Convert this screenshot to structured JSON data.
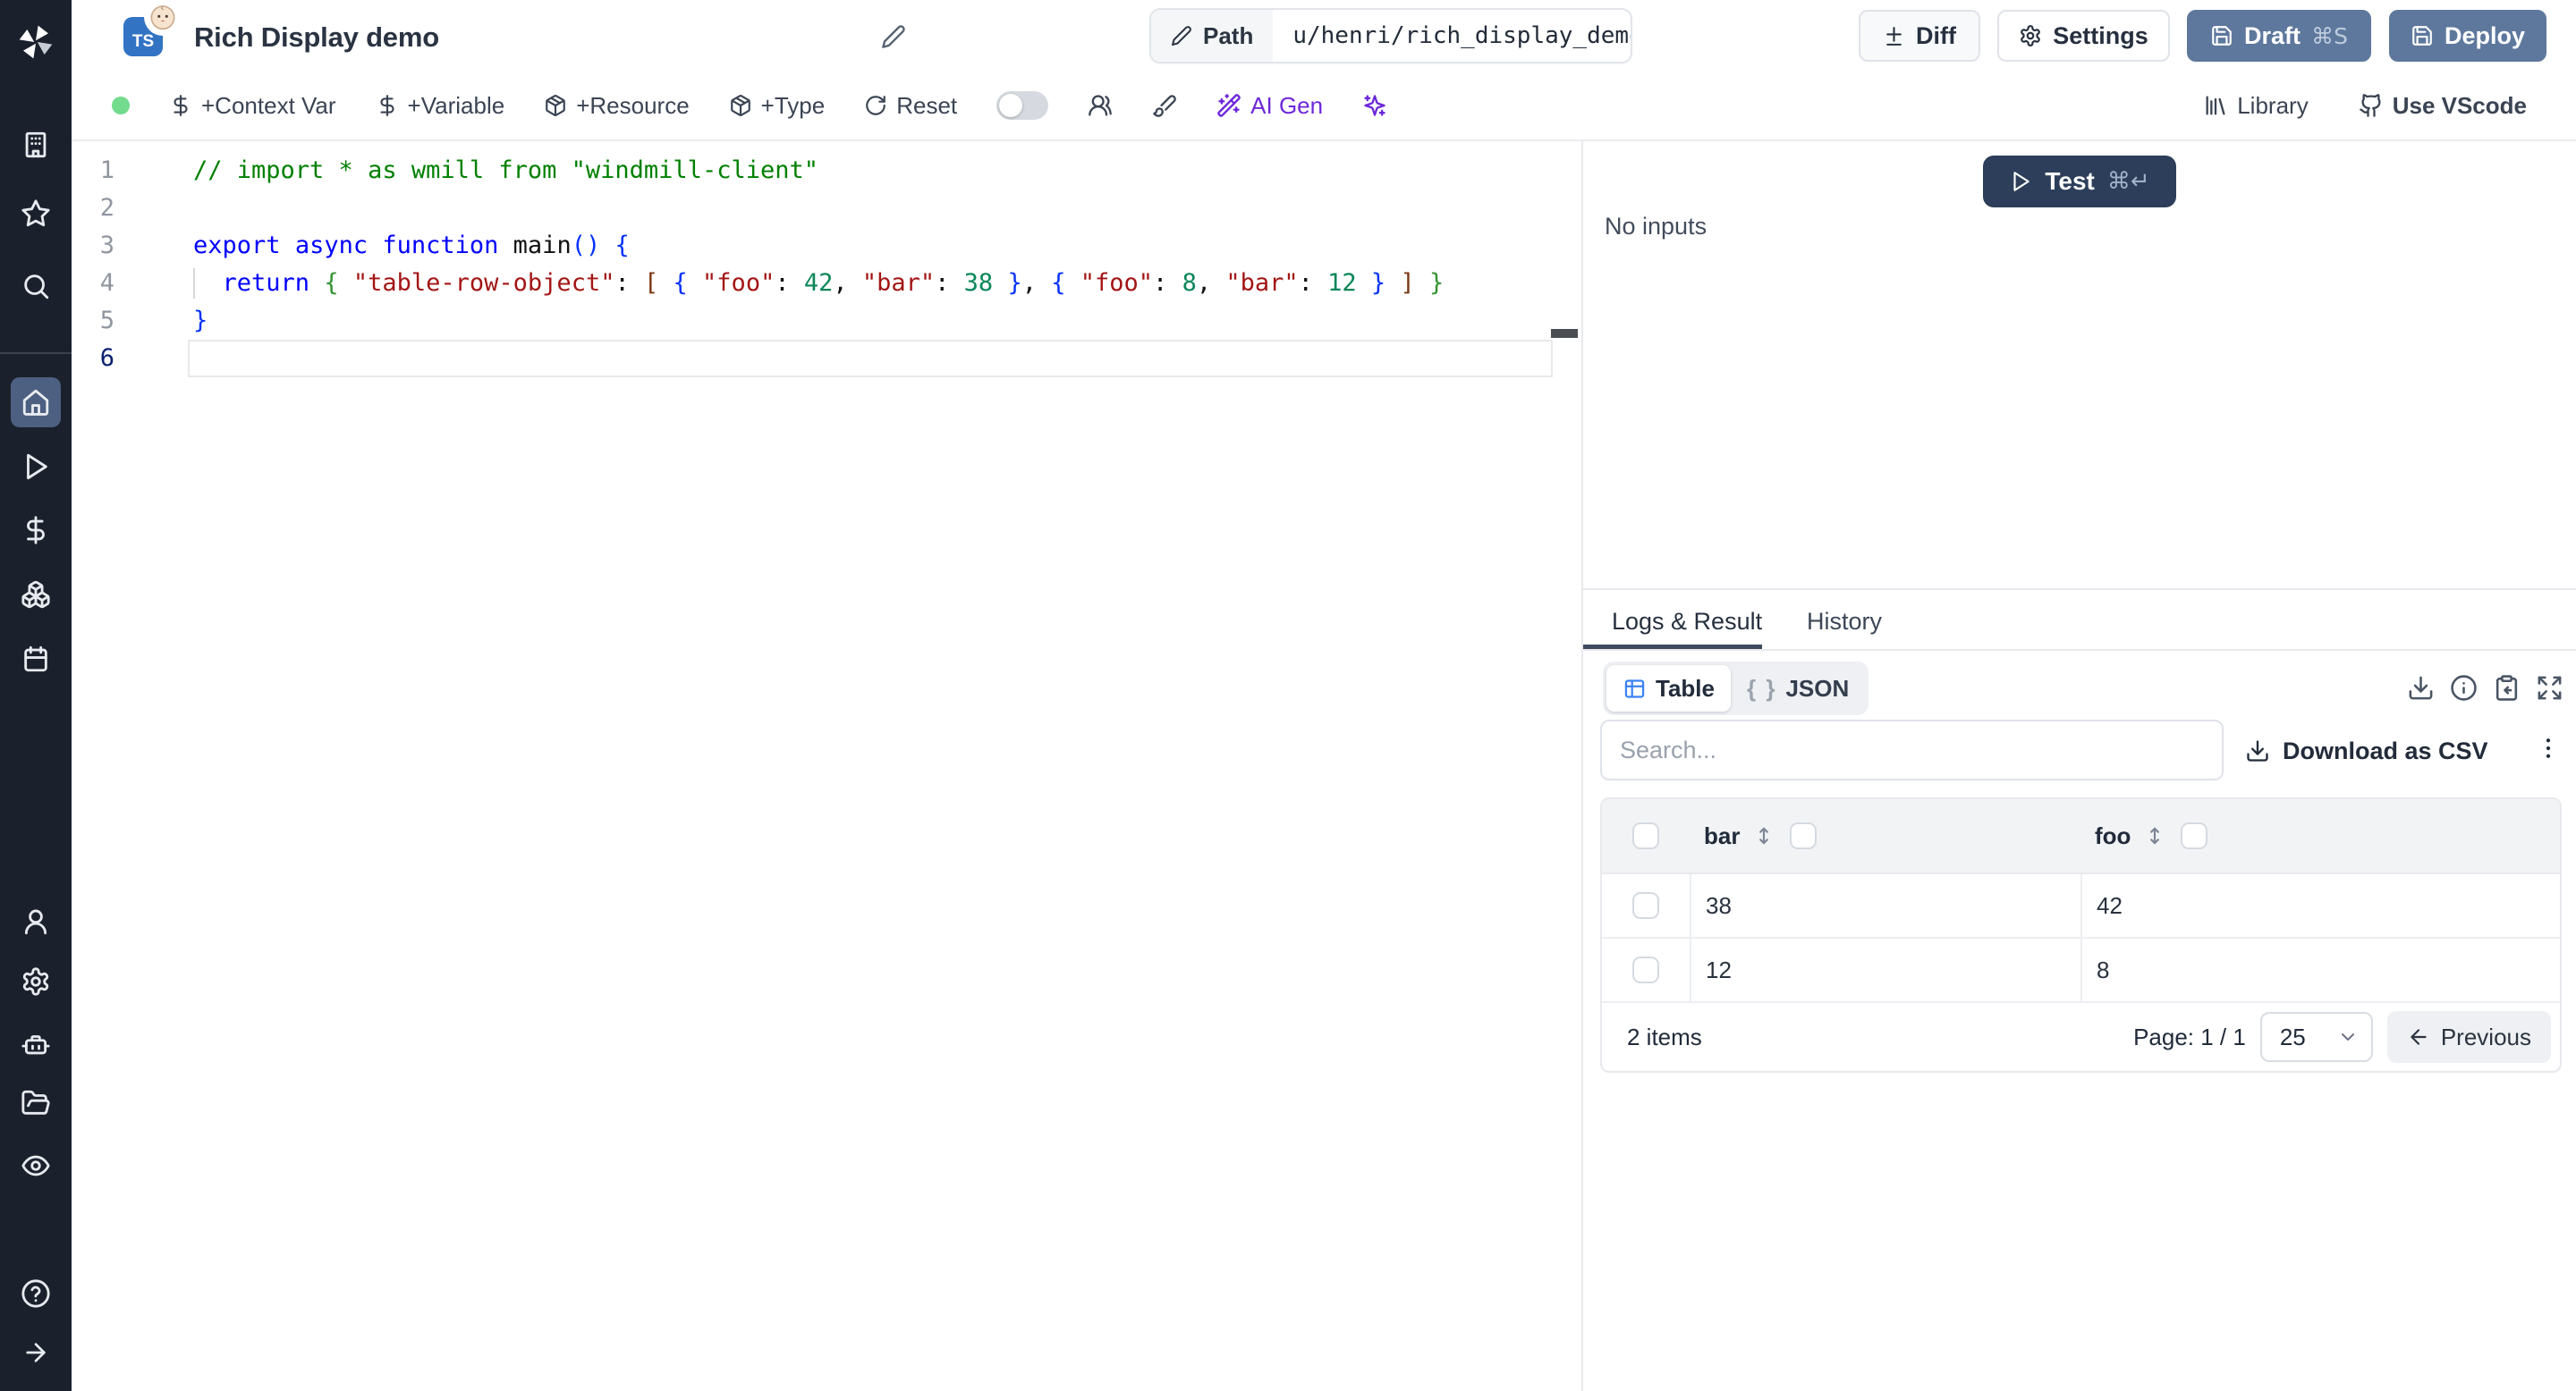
{
  "app": {
    "title": "Rich Display demo",
    "language_badge": "TS"
  },
  "topbar": {
    "path_label": "Path",
    "path_value": "u/henri/rich_display_demo",
    "diff_label": "Diff",
    "settings_label": "Settings",
    "draft_label": "Draft",
    "draft_shortcut": "⌘S",
    "deploy_label": "Deploy"
  },
  "toolbar": {
    "context_var": "+Context Var",
    "variable": "+Variable",
    "resource": "+Resource",
    "type": "+Type",
    "reset": "Reset",
    "ai_gen": "AI Gen",
    "library": "Library",
    "vscode": "Use VScode"
  },
  "sidebar": {
    "top_icons": [
      "windmill-logo",
      "building",
      "star",
      "search"
    ],
    "main_icons": [
      "home",
      "play",
      "dollar",
      "cubes",
      "calendar"
    ],
    "active_icon": "home",
    "bottom_icons": [
      "user",
      "settings",
      "robot",
      "folder-open",
      "eye"
    ],
    "footer_icons": [
      "help",
      "expand-arrow"
    ]
  },
  "editor": {
    "lines": [
      {
        "n": 1,
        "tokens": [
          [
            "// import * as wmill from \"windmill-client\"",
            "comment"
          ]
        ]
      },
      {
        "n": 2,
        "tokens": []
      },
      {
        "n": 3,
        "tokens": [
          [
            "export",
            "kw"
          ],
          [
            " ",
            "pl"
          ],
          [
            "async",
            "kw"
          ],
          [
            " ",
            "pl"
          ],
          [
            "function",
            "kw"
          ],
          [
            " ",
            "pl"
          ],
          [
            "main",
            "fn"
          ],
          [
            "()",
            "b1"
          ],
          [
            " ",
            "pl"
          ],
          [
            "{",
            "b1"
          ]
        ]
      },
      {
        "n": 4,
        "guide": true,
        "tokens": [
          [
            "  ",
            "pl"
          ],
          [
            "return",
            "kw"
          ],
          [
            " ",
            "pl"
          ],
          [
            "{",
            "b2"
          ],
          [
            " ",
            "pl"
          ],
          [
            "\"table-row-object\"",
            "str"
          ],
          [
            ": ",
            "pl"
          ],
          [
            "[",
            "b3"
          ],
          [
            " ",
            "pl"
          ],
          [
            "{",
            "b1"
          ],
          [
            " ",
            "pl"
          ],
          [
            "\"foo\"",
            "str"
          ],
          [
            ": ",
            "pl"
          ],
          [
            "42",
            "num"
          ],
          [
            ", ",
            "pl"
          ],
          [
            "\"bar\"",
            "str"
          ],
          [
            ": ",
            "pl"
          ],
          [
            "38",
            "num"
          ],
          [
            " ",
            "pl"
          ],
          [
            "}",
            "b1"
          ],
          [
            ", ",
            "pl"
          ],
          [
            "{",
            "b1"
          ],
          [
            " ",
            "pl"
          ],
          [
            "\"foo\"",
            "str"
          ],
          [
            ": ",
            "pl"
          ],
          [
            "8",
            "num"
          ],
          [
            ", ",
            "pl"
          ],
          [
            "\"bar\"",
            "str"
          ],
          [
            ": ",
            "pl"
          ],
          [
            "12",
            "num"
          ],
          [
            " ",
            "pl"
          ],
          [
            "}",
            "b1"
          ],
          [
            " ",
            "pl"
          ],
          [
            "]",
            "b3"
          ],
          [
            " ",
            "pl"
          ],
          [
            "}",
            "b2"
          ]
        ]
      },
      {
        "n": 5,
        "tokens": [
          [
            "}",
            "b1"
          ]
        ]
      },
      {
        "n": 6,
        "active": true,
        "tokens": []
      }
    ]
  },
  "run_panel": {
    "test_label": "Test",
    "test_shortcut": "⌘↵",
    "no_inputs_text": "No inputs"
  },
  "result_panel": {
    "tabs": [
      {
        "label": "Logs & Result",
        "active": true
      },
      {
        "label": "History",
        "active": false
      }
    ],
    "view_toggle": [
      {
        "label": "Table",
        "active": true
      },
      {
        "label": "JSON",
        "active": false
      }
    ],
    "toolbar_icons": [
      "download",
      "info",
      "clipboard-paste",
      "expand"
    ],
    "search_placeholder": "Search...",
    "download_csv_label": "Download as CSV",
    "table": {
      "columns": [
        "bar",
        "foo"
      ],
      "rows": [
        [
          "38",
          "42"
        ],
        [
          "12",
          "8"
        ]
      ],
      "items_text": "2 items",
      "page_text": "Page: 1 / 1",
      "page_size": "25",
      "previous_label": "Previous"
    }
  },
  "colors": {
    "primary_button_blue": "#5e789d",
    "test_button_navy": "#2c3e5a",
    "ai_purple": "#6d28d9",
    "ts_badge_blue": "#3273c4",
    "status_green": "#72db8d",
    "table_icon_blue": "#3b82f6",
    "tab_underline": "#3d4a5d",
    "sidebar_bg": "#1b212c",
    "sidebar_active_bg": "#4d6081"
  }
}
